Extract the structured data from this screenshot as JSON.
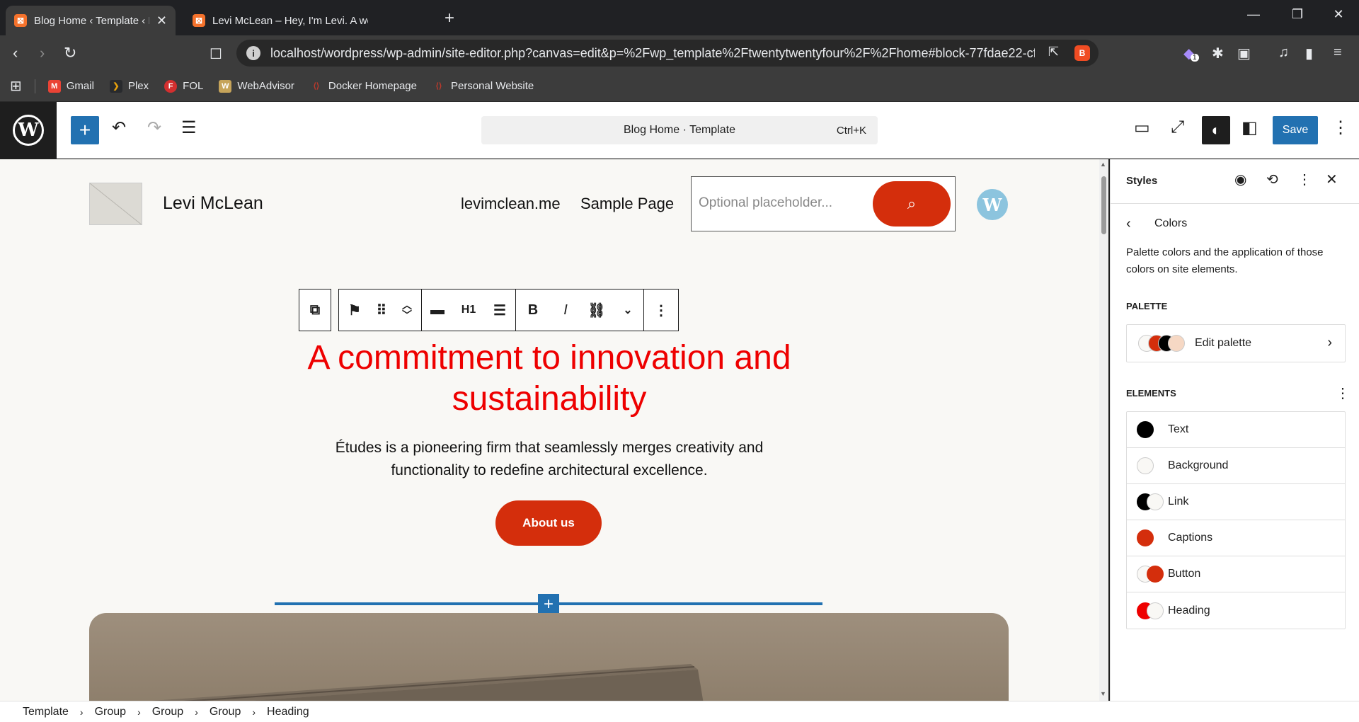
{
  "browser": {
    "tabs": [
      {
        "title": "Blog Home ‹ Template ‹ Levi McLean — WordPress",
        "active": true
      },
      {
        "title": "Levi McLean – Hey, I'm Levi. A web developer",
        "active": false
      }
    ],
    "url": "localhost/wordpress/wp-admin/site-editor.php?canvas=edit&p=%2Fwp_template%2Ftwentytwentyfour%2F%2Fhome#block-77fdae22-cf...",
    "extension_badge": "1",
    "bookmarks": [
      {
        "label": "Gmail",
        "icon": "gmail-icon",
        "color": "#ea4335"
      },
      {
        "label": "Plex",
        "icon": "plex-icon",
        "color": "#e5a00d"
      },
      {
        "label": "FOL",
        "icon": "fol-icon",
        "color": "#d32f2f"
      },
      {
        "label": "WebAdvisor",
        "icon": "webadvisor-icon",
        "color": "#c6a45a"
      },
      {
        "label": "Docker Homepage",
        "icon": "docker-icon",
        "color": "#c0392b"
      },
      {
        "label": "Personal Website",
        "icon": "website-icon",
        "color": "#c0392b"
      }
    ]
  },
  "editor": {
    "command_title": "Blog Home · Template",
    "command_shortcut": "Ctrl+K",
    "save_label": "Save"
  },
  "site": {
    "title": "Levi McLean",
    "nav": [
      "levimclean.me",
      "Sample Page"
    ],
    "search_placeholder": "Optional placeholder...",
    "heading": "A commitment to innovation and sustainability",
    "subtext": "Études is a pioneering firm that seamlessly merges creativity and functionality to redefine architectural excellence.",
    "button": "About us",
    "heading_color": "#ee0000",
    "accent_color": "#d42e0c"
  },
  "block_toolbar": {
    "heading_level": "H1"
  },
  "sidebar": {
    "title": "Styles",
    "section_title": "Colors",
    "description": "Palette colors and the application of those colors on site elements.",
    "palette_heading": "PALETTE",
    "edit_palette": "Edit palette",
    "elements_heading": "ELEMENTS",
    "elements": [
      {
        "label": "Text",
        "swatches": [
          "#000000"
        ]
      },
      {
        "label": "Background",
        "swatches": [
          "#f9f8f5"
        ]
      },
      {
        "label": "Link",
        "swatches": [
          "#000000",
          "#f9f8f5"
        ]
      },
      {
        "label": "Captions",
        "swatches": [
          "#d42e0c"
        ]
      },
      {
        "label": "Button",
        "swatches": [
          "#f9f8f5",
          "#d42e0c"
        ]
      },
      {
        "label": "Heading",
        "swatches": [
          "#ee0000",
          "#f9f8f5"
        ]
      }
    ],
    "palette_swatches": [
      "#f9f8f5",
      "#d42e0c",
      "#000000",
      "#f6d8c4"
    ]
  },
  "breadcrumb": [
    "Template",
    "Group",
    "Group",
    "Group",
    "Heading"
  ]
}
